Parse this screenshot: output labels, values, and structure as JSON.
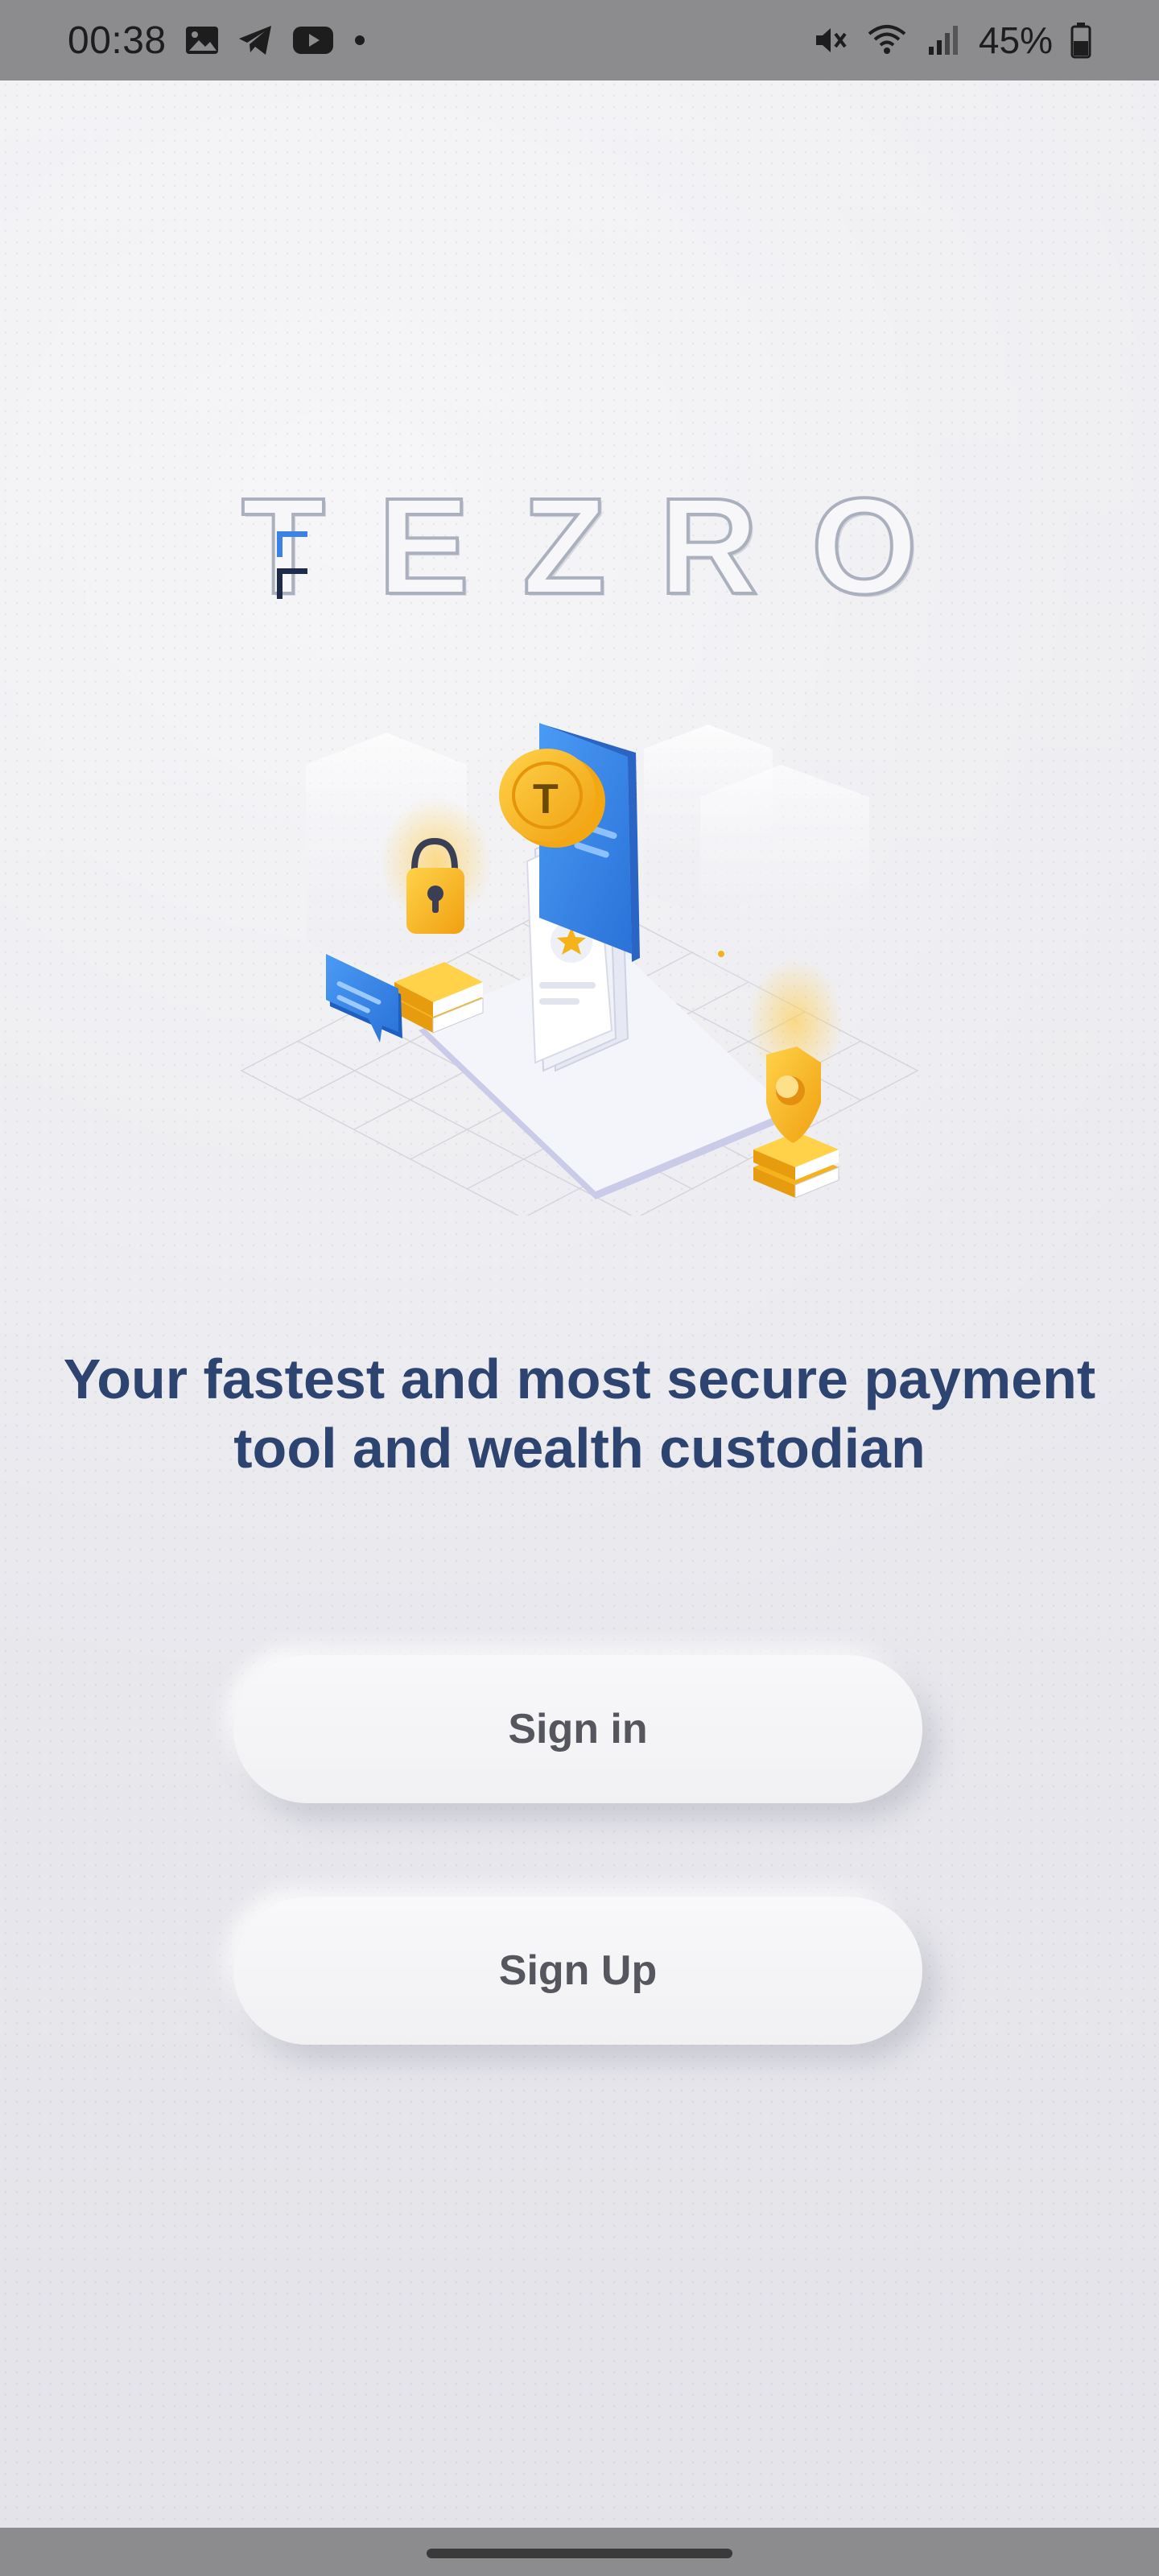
{
  "status_bar": {
    "time": "00:38",
    "notification_icons": [
      "gallery-icon",
      "telegram-icon",
      "youtube-icon",
      "dot-icon"
    ],
    "system_icons": [
      "mute-icon",
      "wifi-icon",
      "signal-icon"
    ],
    "battery_level": "45%"
  },
  "brand": {
    "logo_letters": [
      "T",
      "E",
      "Z",
      "R",
      "O"
    ],
    "logo_accent_color": "#3b82e6"
  },
  "tagline": {
    "line1": "Your fastest and most secure payment",
    "line2": "tool and wealth custodian"
  },
  "buttons": {
    "sign_in": "Sign in",
    "sign_up": "Sign Up"
  },
  "colors": {
    "primary_text": "#2e4470",
    "button_text": "#55565e",
    "accent_blue": "#3b82e6",
    "accent_gold": "#f5b21b"
  }
}
